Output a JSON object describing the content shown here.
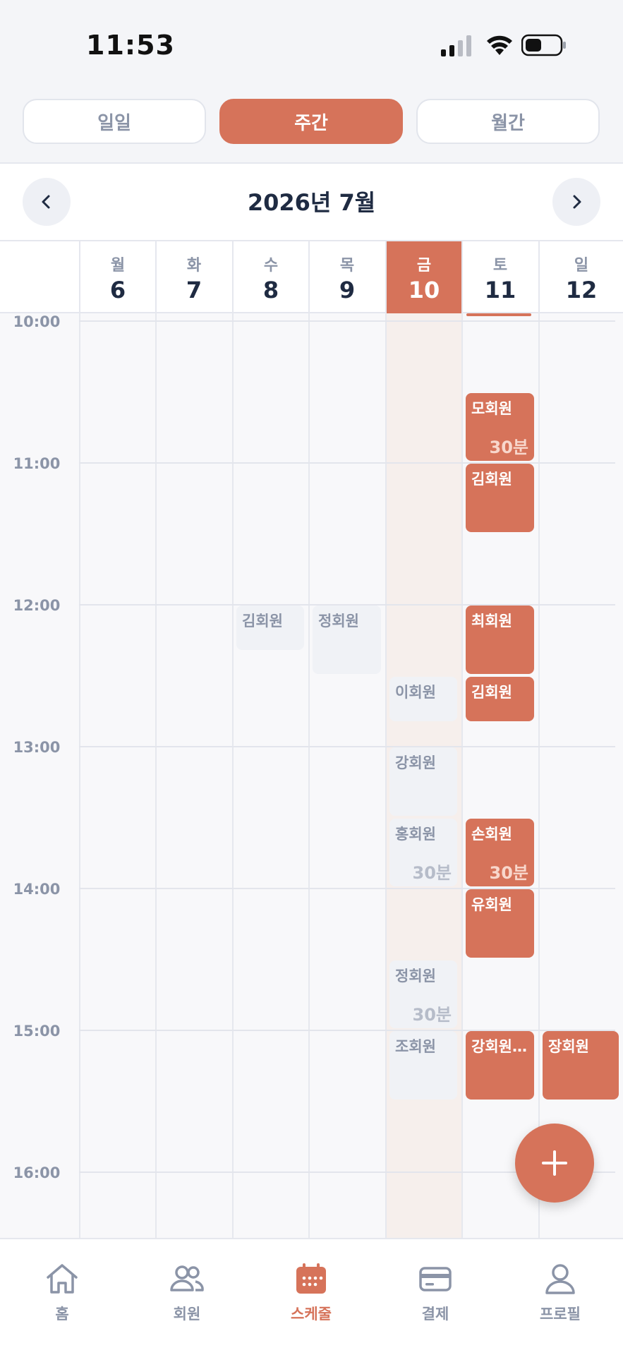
{
  "status_bar": {
    "time": "11:53"
  },
  "view_modes": [
    {
      "label": "일일",
      "active": false
    },
    {
      "label": "주간",
      "active": true
    },
    {
      "label": "월간",
      "active": false
    }
  ],
  "calendar": {
    "month_title": "2026년 7월",
    "days": [
      {
        "name": "월",
        "num": "6",
        "today": false
      },
      {
        "name": "화",
        "num": "7",
        "today": false
      },
      {
        "name": "수",
        "num": "8",
        "today": false
      },
      {
        "name": "목",
        "num": "9",
        "today": false
      },
      {
        "name": "금",
        "num": "10",
        "today": true
      },
      {
        "name": "토",
        "num": "11",
        "today": false
      },
      {
        "name": "일",
        "num": "12",
        "today": false
      }
    ],
    "hours": [
      "10:00",
      "11:00",
      "12:00",
      "13:00",
      "14:00",
      "15:00",
      "16:00"
    ],
    "first_hour": 10,
    "events": [
      {
        "day": 5,
        "start": "10:30",
        "duration": 30,
        "name": "모회원",
        "duration_label": "30분",
        "status": "upcoming"
      },
      {
        "day": 5,
        "start": "11:00",
        "duration": 30,
        "name": "김회원",
        "duration_label": "",
        "status": "upcoming"
      },
      {
        "day": 2,
        "start": "12:00",
        "duration": 20,
        "name": "김회원",
        "duration_label": "",
        "status": "past"
      },
      {
        "day": 3,
        "start": "12:00",
        "duration": 30,
        "name": "정회원",
        "duration_label": "",
        "status": "past"
      },
      {
        "day": 5,
        "start": "12:00",
        "duration": 30,
        "name": "최회원",
        "duration_label": "",
        "status": "upcoming"
      },
      {
        "day": 4,
        "start": "12:30",
        "duration": 20,
        "name": "이회원",
        "duration_label": "",
        "status": "past"
      },
      {
        "day": 5,
        "start": "12:30",
        "duration": 20,
        "name": "김회원",
        "duration_label": "",
        "status": "upcoming"
      },
      {
        "day": 4,
        "start": "13:00",
        "duration": 30,
        "name": "강회원",
        "duration_label": "",
        "status": "past"
      },
      {
        "day": 4,
        "start": "13:30",
        "duration": 30,
        "name": "홍회원",
        "duration_label": "30분",
        "status": "past"
      },
      {
        "day": 5,
        "start": "13:30",
        "duration": 30,
        "name": "손회원",
        "duration_label": "30분",
        "status": "upcoming"
      },
      {
        "day": 5,
        "start": "14:00",
        "duration": 30,
        "name": "유회원",
        "duration_label": "",
        "status": "upcoming"
      },
      {
        "day": 4,
        "start": "14:30",
        "duration": 30,
        "name": "정회원",
        "duration_label": "30분",
        "status": "past"
      },
      {
        "day": 4,
        "start": "15:00",
        "duration": 30,
        "name": "조회원",
        "duration_label": "",
        "status": "past"
      },
      {
        "day": 5,
        "start": "15:00",
        "duration": 30,
        "name": "강회원...",
        "duration_label": "",
        "status": "upcoming"
      },
      {
        "day": 6,
        "start": "15:00",
        "duration": 30,
        "name": "장회원",
        "duration_label": "",
        "status": "upcoming"
      }
    ]
  },
  "fab": {
    "icon": "plus-icon"
  },
  "tab_bar": [
    {
      "label": "홈",
      "icon": "home-icon",
      "active": false
    },
    {
      "label": "회원",
      "icon": "members-icon",
      "active": false
    },
    {
      "label": "스케줄",
      "icon": "calendar-icon",
      "active": true
    },
    {
      "label": "결제",
      "icon": "card-icon",
      "active": false
    },
    {
      "label": "프로필",
      "icon": "profile-icon",
      "active": false
    }
  ],
  "colors": {
    "accent": "#d6735a",
    "muted_text": "#8b94a7",
    "dark_text": "#1f2b42",
    "past_event_bg": "#f0f2f6",
    "today_column_bg": "#f6efec"
  }
}
